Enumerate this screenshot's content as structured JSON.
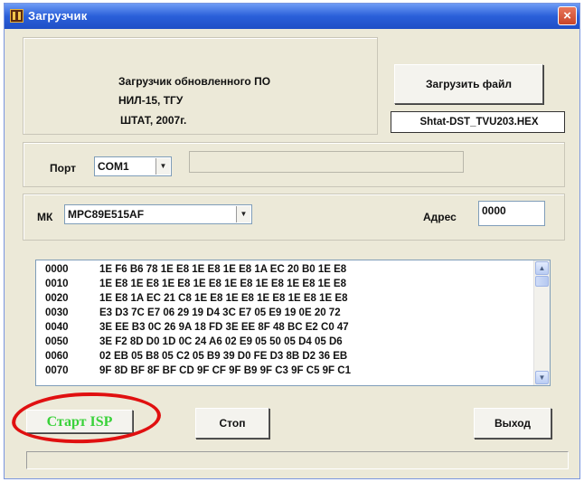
{
  "window": {
    "title": "Загрузчик",
    "close_label": "×"
  },
  "info": {
    "line1": "Загрузчик обновленного ПО",
    "line2": "НИЛ-15, ТГУ",
    "line3": "ШТАТ, 2007г."
  },
  "file": {
    "load_button": "Загрузить файл",
    "filename": "Shtat-DST_TVU203.HEX"
  },
  "port": {
    "label": "Порт",
    "selected": "COM1",
    "status": ""
  },
  "mcu": {
    "label": "МК",
    "selected": "MPC89E515AF",
    "address_label": "Адрес",
    "address_value": "0000"
  },
  "hex": {
    "rows": [
      {
        "addr": "0000",
        "bytes": "1E F6 B6 78 1E E8 1E E8 1E E8 1A EC 20 B0 1E E8"
      },
      {
        "addr": "0010",
        "bytes": "1E E8 1E E8 1E E8 1E E8 1E E8 1E E8 1E E8 1E E8"
      },
      {
        "addr": "0020",
        "bytes": "1E E8 1A EC 21 C8 1E E8 1E E8 1E E8 1E E8 1E E8"
      },
      {
        "addr": "0030",
        "bytes": "E3 D3 7C E7 06 29 19 D4 3C E7 05 E9 19 0E 20 72"
      },
      {
        "addr": "0040",
        "bytes": "3E EE B3 0C 26 9A 18 FD 3E EE 8F 48 BC E2 C0 47"
      },
      {
        "addr": "0050",
        "bytes": "3E F2 8D D0 1D 0C 24 A6 02 E9 05 50 05 D4 05 D6"
      },
      {
        "addr": "0060",
        "bytes": "02 EB 05 B8 05 C2 05 B9 39 D0 FE D3 8B D2 36 EB"
      },
      {
        "addr": "0070",
        "bytes": "9F 8D BF 8F BF CD 9F CF 9F B9 9F C3 9F C5 9F C1"
      }
    ]
  },
  "actions": {
    "start": "Старт ISP",
    "stop": "Стоп",
    "exit": "Выход"
  },
  "colors": {
    "start_text": "#3ad23a",
    "annotation_circle": "#e01010",
    "titlebar": "#2a5fd9"
  }
}
